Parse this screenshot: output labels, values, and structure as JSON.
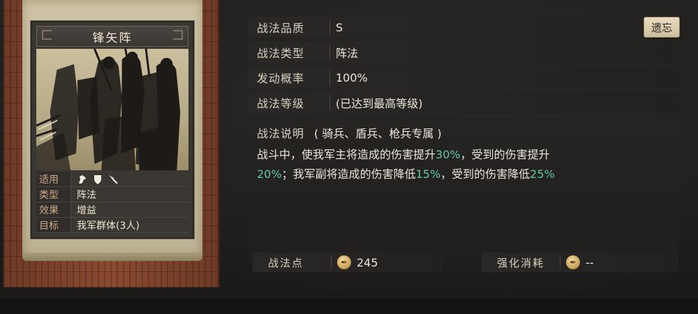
{
  "card": {
    "title": "锋矢阵",
    "info": [
      {
        "key": "适用",
        "value": "",
        "icons": [
          "cavalry-horse-icon",
          "shield-icon",
          "spear-icon"
        ]
      },
      {
        "key": "类型",
        "value": "阵法"
      },
      {
        "key": "效果",
        "value": "增益"
      },
      {
        "key": "目标",
        "value": "我军群体(3人)"
      }
    ]
  },
  "rows": {
    "quality": {
      "label": "战法品质",
      "value": "S"
    },
    "type": {
      "label": "战法类型",
      "value": "阵法"
    },
    "rate": {
      "label": "发动概率",
      "value": "100%"
    },
    "level": {
      "label": "战法等级",
      "value": "(已达到最高等级)"
    }
  },
  "forget_button": "遗忘",
  "description": {
    "title": "战法说明",
    "scope": "( 骑兵、盾兵、枪兵专属 )",
    "parts": [
      {
        "text": "战斗中，使我军主将造成的伤害提升",
        "hl": false
      },
      {
        "text": "30%",
        "hl": true
      },
      {
        "text": "，受到的伤害提升",
        "hl": false
      },
      {
        "text": "20%",
        "hl": true
      },
      {
        "text": "；我军副将造成的伤害降低",
        "hl": false
      },
      {
        "text": "15%",
        "hl": true
      },
      {
        "text": "，受到的伤害降低",
        "hl": false
      },
      {
        "text": "25%",
        "hl": true
      }
    ]
  },
  "footer": {
    "points": {
      "label": "战法点",
      "value": "245"
    },
    "cost": {
      "label": "强化消耗",
      "value": "--"
    }
  },
  "colors": {
    "highlight": "#5fc7a3",
    "label": "#c9a983",
    "button": "#e8dcc0"
  }
}
